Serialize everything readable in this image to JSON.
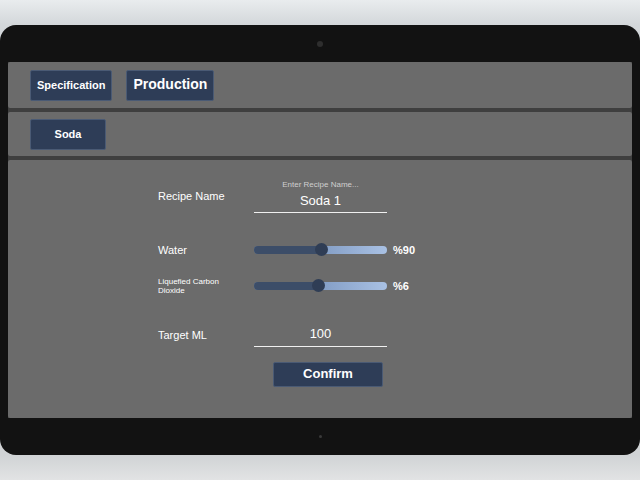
{
  "tabs": [
    {
      "label": "Specification",
      "selected": false
    },
    {
      "label": "Production",
      "selected": true
    }
  ],
  "categories": [
    {
      "label": "Soda"
    }
  ],
  "recipe_name": {
    "label": "Recipe Name",
    "placeholder": "Enter Recipe Name...",
    "value": "Soda 1"
  },
  "ingredients": [
    {
      "label": "Water",
      "level": 0.5,
      "reading": "%90"
    },
    {
      "label": "Liquefied Carbon Dioxide",
      "level": 0.48,
      "reading": "%6"
    }
  ],
  "target": {
    "label": "Target ML",
    "value": "100"
  },
  "buttons": [
    "Confirm"
  ]
}
